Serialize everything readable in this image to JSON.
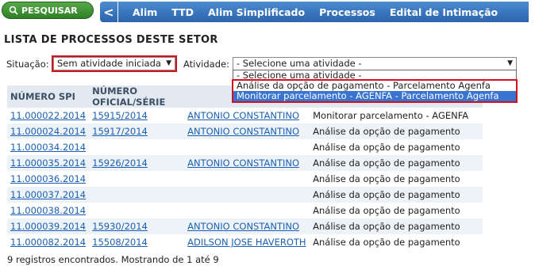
{
  "topbar": {
    "search_label": "PESQUISAR",
    "back_label": "<",
    "nav": [
      "Alim",
      "TTD",
      "Alim Simplificado",
      "Processos",
      "Edital de Intimação"
    ]
  },
  "page_title": "LISTA DE PROCESSOS DESTE SETOR",
  "filters": {
    "situacao_label": "Situação:",
    "situacao_value": "Sem atividade iniciada",
    "atividade_label": "Atividade:",
    "atividade_value": "- Selecione uma atividade -",
    "atividade_options": [
      "- Selecione uma atividade -",
      "Análise da opção de pagamento - Parcelamento Agenfa",
      "Monitorar parcelamento - AGENFA - Parcelamento Agenfa"
    ]
  },
  "table": {
    "headers": [
      "NÚMERO SPI",
      "NÚMERO OFICIAL/SÉRIE",
      "",
      ""
    ],
    "rows": [
      [
        "11.000022.2014",
        "15915/2014",
        "ANTONIO CONSTANTINO",
        "Monitorar parcelamento - AGENFA"
      ],
      [
        "11.000024.2014",
        "15917/2014",
        "ANTONIO CONSTANTINO",
        "Análise da opção de pagamento"
      ],
      [
        "11.000034.2014",
        "",
        "",
        "Análise da opção de pagamento"
      ],
      [
        "11.000035.2014",
        "15926/2014",
        "ANTONIO CONSTANTINO",
        "Análise da opção de pagamento"
      ],
      [
        "11.000036.2014",
        "",
        "",
        "Análise da opção de pagamento"
      ],
      [
        "11.000037.2014",
        "",
        "",
        "Análise da opção de pagamento"
      ],
      [
        "11.000038.2014",
        "",
        "",
        "Análise da opção de pagamento"
      ],
      [
        "11.000039.2014",
        "15930/2014",
        "ANTONIO CONSTANTINO",
        "Análise da opção de pagamento"
      ],
      [
        "11.000082.2014",
        "15508/2014",
        "ADILSON JOSE HAVEROTH",
        "Análise da opção de pagamento"
      ]
    ]
  },
  "footer": "9 registros encontrados. Mostrando de 1 até 9",
  "colors": {
    "accent": "#2a64ad",
    "search_green": "#2f7f24",
    "highlight": "#3a74d1",
    "callout": "#d2121f"
  }
}
